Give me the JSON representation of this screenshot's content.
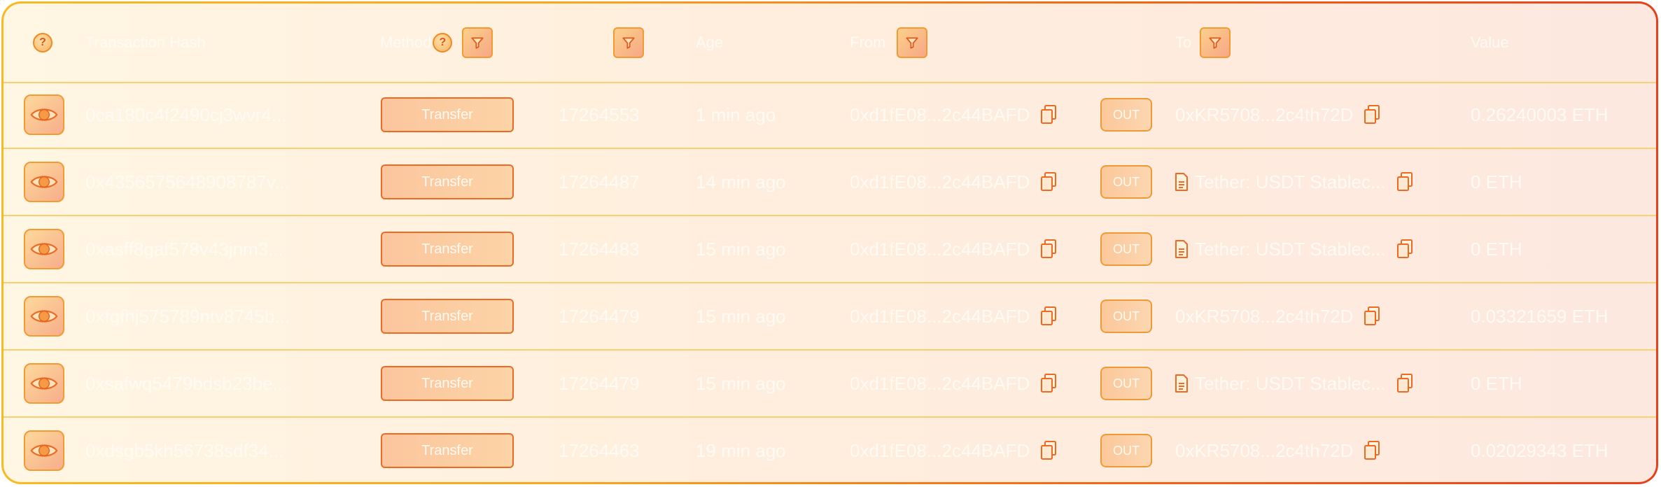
{
  "header": {
    "txhash": "Transaction Hash",
    "method": "Method",
    "age": "Age",
    "from": "From",
    "to": "To",
    "value": "Value",
    "help_glyph": "?"
  },
  "colors": {
    "accent_orange": "#f26a14",
    "accent_yellow": "#f8ba22",
    "text": "#fffaf3"
  },
  "icons": [
    "help-icon",
    "filter-icon",
    "eye-icon",
    "copy-icon",
    "document-icon"
  ],
  "rows": [
    {
      "hash": "0ca180c4f2490cj3wvr4...",
      "method": "Transfer",
      "block": "17264553",
      "age": "1 min ago",
      "from": "0xd1fE08...2c44BAFD",
      "direction": "OUT",
      "to": "0xKR5708...2c4th72D",
      "value": "0.26240003 ETH"
    },
    {
      "hash": "0x4356575648908787v...",
      "method": "Transfer",
      "block": "17264487",
      "age": "14 min ago",
      "from": "0xd1fE08...2c44BAFD",
      "direction": "OUT",
      "to": "Tether: USDT Stablec...",
      "value": "0 ETH"
    },
    {
      "hash": "0xasff8gaf578v43jnm3...",
      "method": "Transfer",
      "block": "17264483",
      "age": "15 min ago",
      "from": "0xd1fE08...2c44BAFD",
      "direction": "OUT",
      "to": "Tether: USDT Stablec...",
      "value": "0 ETH"
    },
    {
      "hash": "0xfgfhj575789ntv8745b...",
      "method": "Transfer",
      "block": "17264479",
      "age": "15 min ago",
      "from": "0xd1fE08...2c44BAFD",
      "direction": "OUT",
      "to": "0xKR5708...2c4th72D",
      "value": "0.03321659 ETH"
    },
    {
      "hash": "0xsafwq5479bdsb23be...",
      "method": "Transfer",
      "block": "17264479",
      "age": "15 min ago",
      "from": "0xd1fE08...2c44BAFD",
      "direction": "OUT",
      "to": "Tether: USDT Stablec...",
      "value": "0 ETH"
    },
    {
      "hash": "0xdsgb5kh56738sdf34...",
      "method": "Transfer",
      "block": "17264463",
      "age": "19 min ago",
      "from": "0xd1fE08...2c44BAFD",
      "direction": "OUT",
      "to": "0xKR5708...2c4th72D",
      "value": "0.02029343 ETH"
    }
  ]
}
